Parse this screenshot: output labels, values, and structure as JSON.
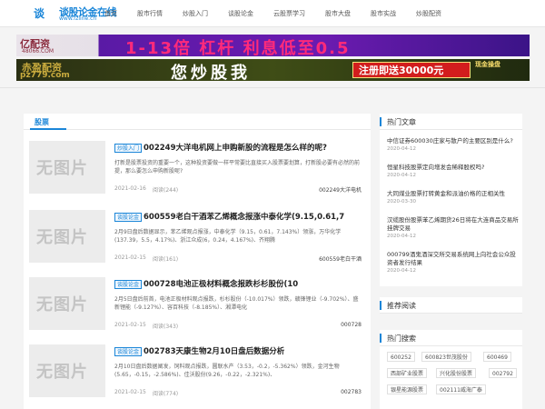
{
  "logo": {
    "name": "谈股论金在线",
    "url": "www.fzline.cn",
    "mark": "谈"
  },
  "nav": [
    "首页",
    "股市行情",
    "炒股入门",
    "谈股论金",
    "云股票学习",
    "股市大盘",
    "股市实战",
    "炒股配资"
  ],
  "banner1": {
    "logo": "亿配资",
    "url": "48066.COM",
    "text": "1-13倍 杠杆 利息低至0.5"
  },
  "banner2": {
    "logo": "赤盈配资",
    "url": "pz779.com",
    "text": "您炒股我",
    "cta": "注册即送30000元",
    "side": "现金操盘"
  },
  "main": {
    "tab": "股票",
    "articles": [
      {
        "thumb": "无图片",
        "category": "炒股入门",
        "title": "002249大洋电机网上申购新股的流程是怎么样的呢?",
        "summary": "打新是股票投资的重要一个，这种投资要做一样平常要比直接买入股票要划算，打新股必要有必然的前提，那么要怎么申购新股呢?",
        "date": "2021-02-16",
        "views": "阅读(244)",
        "tag": "002249大洋电机"
      },
      {
        "thumb": "无图片",
        "category": "谈股论金",
        "title": "600559老白干酒苯乙烯概念报涨中泰化学(9.15,0.61,7",
        "summary": "2月9日盘后数据显示，苯乙烯观点报涨，中泰化学（9.15，0.61，7.143%）领涨，万华化学(137.39，5.5，4.17%)、浙江众成(6，0.24，4.167%)、齐翔腾",
        "date": "2021-02-15",
        "views": "阅读(161)",
        "tag": "600559老白干酒"
      },
      {
        "thumb": "无图片",
        "category": "谈股论金",
        "title": "000728电池正极材料概念报跌杉杉股份(10",
        "summary": "2月5日盘后前首，电池正极材料观点报跌，杉杉股份（-10.017%）领跌，赣锋锂业（-9.702%）、盛新锂能（-9.127%）、容百科技（-8.185%）、湘潭电化",
        "date": "2021-02-15",
        "views": "阅读(343)",
        "tag": "000728"
      },
      {
        "thumb": "无图片",
        "category": "谈股论金",
        "title": "002783天康生物2月10日盘后数据分析",
        "summary": "2月10日盘后数据阐发，饲料观点报跌，圆联水产（3.53，-0.2，-5.362%）领跌，金河生物(5.65，-0.15，-2.586%)、佳沃股份(9.26，-0.22，-2.321%)、",
        "date": "2021-02-15",
        "views": "阅读(774)",
        "tag": "002783"
      }
    ]
  },
  "sidebar": {
    "hot_title": "热门文章",
    "hot": [
      {
        "title": "中信证券600030庄家与散户的主要区别是什么?",
        "date": "2020-04-12"
      },
      {
        "title": "恒星科技股票定向增发会稀释股权吗?",
        "date": "2020-04-12"
      },
      {
        "title": "大同煤业股票打转黄金和派油价格的正相关性",
        "date": "2020-03-30"
      },
      {
        "title": "汉缆股份股票苯乙烯期货26日将在大连商品交易所挂牌交易",
        "date": "2020-04-12"
      },
      {
        "title": "000799酒鬼酒深交所交易系统网上向社会公众投资者发行结果",
        "date": "2020-04-12"
      }
    ],
    "recommend_title": "推荐阅读",
    "search_title": "热门搜索",
    "tags": [
      "600252",
      "600823世茂股份",
      "600469",
      "西部矿业股票",
      "兴化股份股票",
      "002792",
      "银星能源股票",
      "002111威海广泰"
    ]
  }
}
